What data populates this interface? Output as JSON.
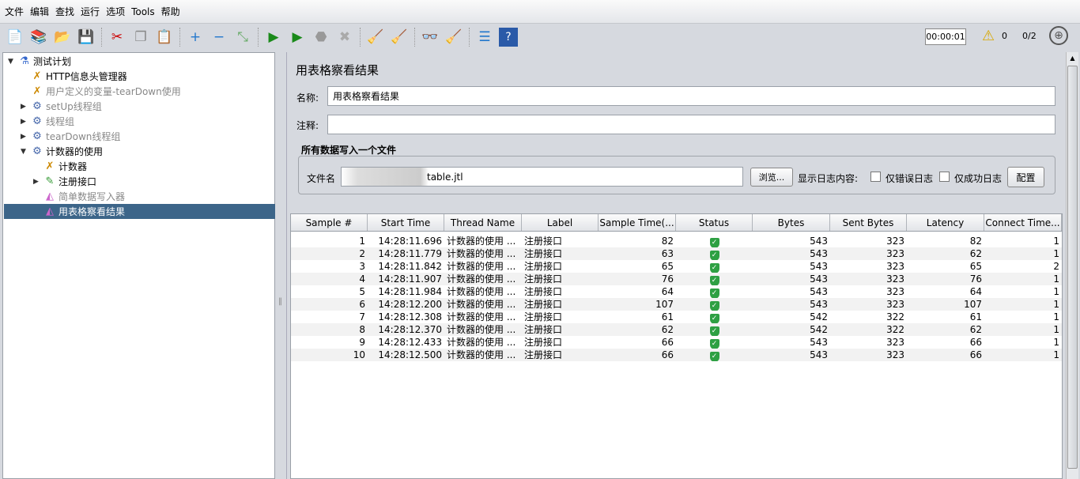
{
  "menu": [
    "文件",
    "编辑",
    "查找",
    "运行",
    "选项",
    "Tools",
    "帮助"
  ],
  "toolbar": {
    "timer": "00:00:01",
    "warnings": "0",
    "threads": "0/2",
    "icons": [
      "new-icon",
      "templates-icon",
      "open-icon",
      "save-icon",
      "|",
      "cut-icon",
      "copy-icon",
      "paste-icon",
      "|",
      "expand-icon",
      "collapse-icon",
      "toggle-icon",
      "|",
      "start-icon",
      "start-no-timers-icon",
      "stop-icon",
      "shutdown-icon",
      "|",
      "clear-icon",
      "clear-all-icon",
      "|",
      "search-icon",
      "reset-search-icon",
      "|",
      "function-helper-icon",
      "help-icon"
    ]
  },
  "tree": [
    {
      "label": "测试计划",
      "level": 0,
      "toggle": "▼",
      "icon": "test-plan",
      "disabled": false
    },
    {
      "label": "HTTP信息头管理器",
      "level": 1,
      "toggle": "",
      "icon": "config",
      "disabled": false
    },
    {
      "label": "用户定义的变量-tearDown使用",
      "level": 1,
      "toggle": "",
      "icon": "config",
      "disabled": true
    },
    {
      "label": "setUp线程组",
      "level": 1,
      "toggle": "▶",
      "icon": "thread-group",
      "disabled": true
    },
    {
      "label": "线程组",
      "level": 1,
      "toggle": "▶",
      "icon": "thread-group",
      "disabled": true
    },
    {
      "label": "tearDown线程组",
      "level": 1,
      "toggle": "▶",
      "icon": "thread-group",
      "disabled": true
    },
    {
      "label": "计数器的使用",
      "level": 1,
      "toggle": "▼",
      "icon": "thread-group",
      "disabled": false
    },
    {
      "label": "计数器",
      "level": 2,
      "toggle": "",
      "icon": "config",
      "disabled": false
    },
    {
      "label": "注册接口",
      "level": 2,
      "toggle": "▶",
      "icon": "sampler",
      "disabled": false
    },
    {
      "label": "简单数据写入器",
      "level": 2,
      "toggle": "",
      "icon": "listener",
      "disabled": true
    },
    {
      "label": "用表格察看结果",
      "level": 2,
      "toggle": "",
      "icon": "listener",
      "disabled": false,
      "selected": true
    }
  ],
  "panel": {
    "title": "用表格察看结果",
    "name_label": "名称:",
    "name_value": "用表格察看结果",
    "comment_label": "注释:",
    "comment_value": "",
    "file_section": "所有数据写入一个文件",
    "filename_label": "文件名",
    "filename_value": "table.jtl",
    "browse": "浏览...",
    "log_label": "显示日志内容:",
    "errors_only": "仅错误日志",
    "success_only": "仅成功日志",
    "configure": "配置"
  },
  "table": {
    "columns": [
      "Sample #",
      "Start Time",
      "Thread Name",
      "Label",
      "Sample Time(...",
      "Status",
      "Bytes",
      "Sent Bytes",
      "Latency",
      "Connect Time..."
    ],
    "rows": [
      [
        "1",
        "14:28:11.696",
        "计数器的使用 ...",
        "注册接口",
        "82",
        "success",
        "543",
        "323",
        "82",
        "1"
      ],
      [
        "2",
        "14:28:11.779",
        "计数器的使用 ...",
        "注册接口",
        "63",
        "success",
        "543",
        "323",
        "62",
        "1"
      ],
      [
        "3",
        "14:28:11.842",
        "计数器的使用 ...",
        "注册接口",
        "65",
        "success",
        "543",
        "323",
        "65",
        "2"
      ],
      [
        "4",
        "14:28:11.907",
        "计数器的使用 ...",
        "注册接口",
        "76",
        "success",
        "543",
        "323",
        "76",
        "1"
      ],
      [
        "5",
        "14:28:11.984",
        "计数器的使用 ...",
        "注册接口",
        "64",
        "success",
        "543",
        "323",
        "64",
        "1"
      ],
      [
        "6",
        "14:28:12.200",
        "计数器的使用 ...",
        "注册接口",
        "107",
        "success",
        "543",
        "323",
        "107",
        "1"
      ],
      [
        "7",
        "14:28:12.308",
        "计数器的使用 ...",
        "注册接口",
        "61",
        "success",
        "542",
        "322",
        "61",
        "1"
      ],
      [
        "8",
        "14:28:12.370",
        "计数器的使用 ...",
        "注册接口",
        "62",
        "success",
        "542",
        "322",
        "62",
        "1"
      ],
      [
        "9",
        "14:28:12.433",
        "计数器的使用 ...",
        "注册接口",
        "66",
        "success",
        "543",
        "323",
        "66",
        "1"
      ],
      [
        "10",
        "14:28:12.500",
        "计数器的使用 ...",
        "注册接口",
        "66",
        "success",
        "543",
        "323",
        "66",
        "1"
      ]
    ]
  },
  "colors": {
    "selection": "#3c6589",
    "success": "#2ea043"
  }
}
